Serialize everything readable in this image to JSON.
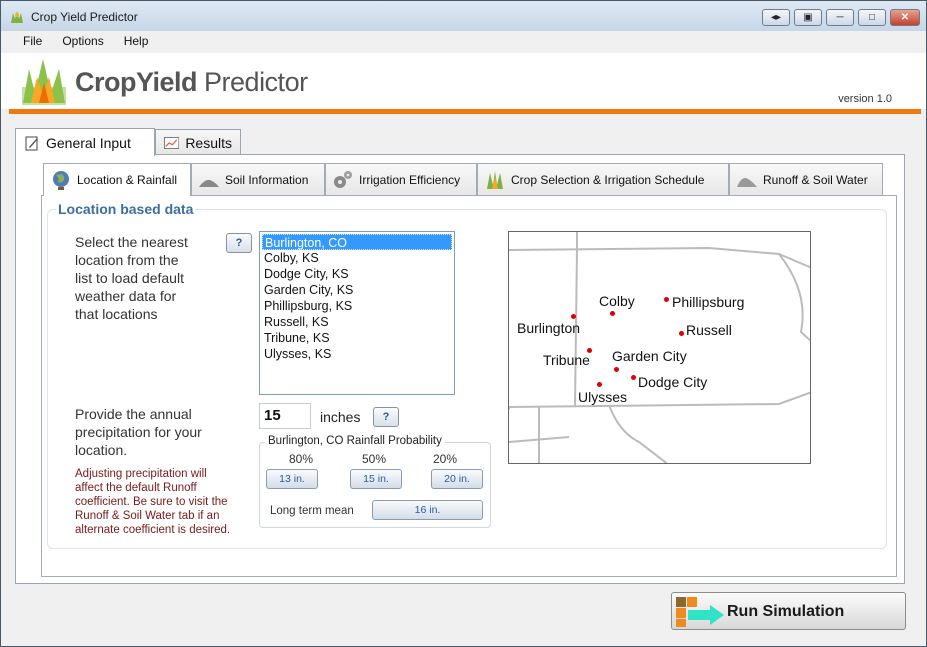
{
  "window": {
    "title": "Crop Yield Predictor"
  },
  "menu": {
    "items": [
      "File",
      "Options",
      "Help"
    ]
  },
  "header": {
    "brand_a": "CropYield",
    "brand_b": "Predictor",
    "version": "version 1.0",
    "accent_color": "#f0780f"
  },
  "main_tabs": [
    {
      "label": "General Input",
      "icon": "pencil-icon"
    },
    {
      "label": "Results",
      "icon": "chart-icon"
    }
  ],
  "sub_tabs": [
    {
      "label": "Location & Rainfall",
      "icon": "globe-icon"
    },
    {
      "label": "Soil Information",
      "icon": "soil-icon"
    },
    {
      "label": "Irrigation Efficiency",
      "icon": "gears-icon"
    },
    {
      "label": "Crop Selection & Irrigation Schedule",
      "icon": "crop-icon"
    },
    {
      "label": "Runoff & Soil Water",
      "icon": "runoff-icon"
    }
  ],
  "location": {
    "group_title": "Location based data",
    "instructions_lines": [
      "Select the nearest",
      "location from the",
      "list to load default",
      "weather data for",
      "that locations"
    ],
    "locations": [
      "Burlington, CO",
      "Colby, KS",
      "Dodge City, KS",
      "Garden City, KS",
      "Phillipsburg, KS",
      "Russell, KS",
      "Tribune, KS",
      "Ulysses, KS"
    ],
    "selected_index": 0,
    "help_label": "?"
  },
  "precip": {
    "instructions_lines": [
      "Provide the annual",
      "precipitation for your",
      "location."
    ],
    "value": "15",
    "unit": "inches",
    "help_label": "?",
    "note_lines": [
      "Adjusting precipitation will",
      "affect the default Runoff",
      "coefficient.  Be sure to visit the",
      "Runoff & Soil Water tab if an",
      "alternate coefficient is desired."
    ],
    "probability": {
      "title": "Burlington, CO Rainfall Probability",
      "percents": [
        "80%",
        "50%",
        "20%"
      ],
      "values": [
        "13 in.",
        "15 in.",
        "20 in."
      ],
      "long_term_label": "Long term mean",
      "long_term_value": "16 in."
    }
  },
  "map": {
    "cities": [
      "Colby",
      "Phillipsburg",
      "Burlington",
      "Russell",
      "Tribune",
      "Garden City",
      "Dodge City",
      "Ulysses"
    ],
    "dot_color": "#e00000"
  },
  "run_button": {
    "label": "Run Simulation"
  }
}
